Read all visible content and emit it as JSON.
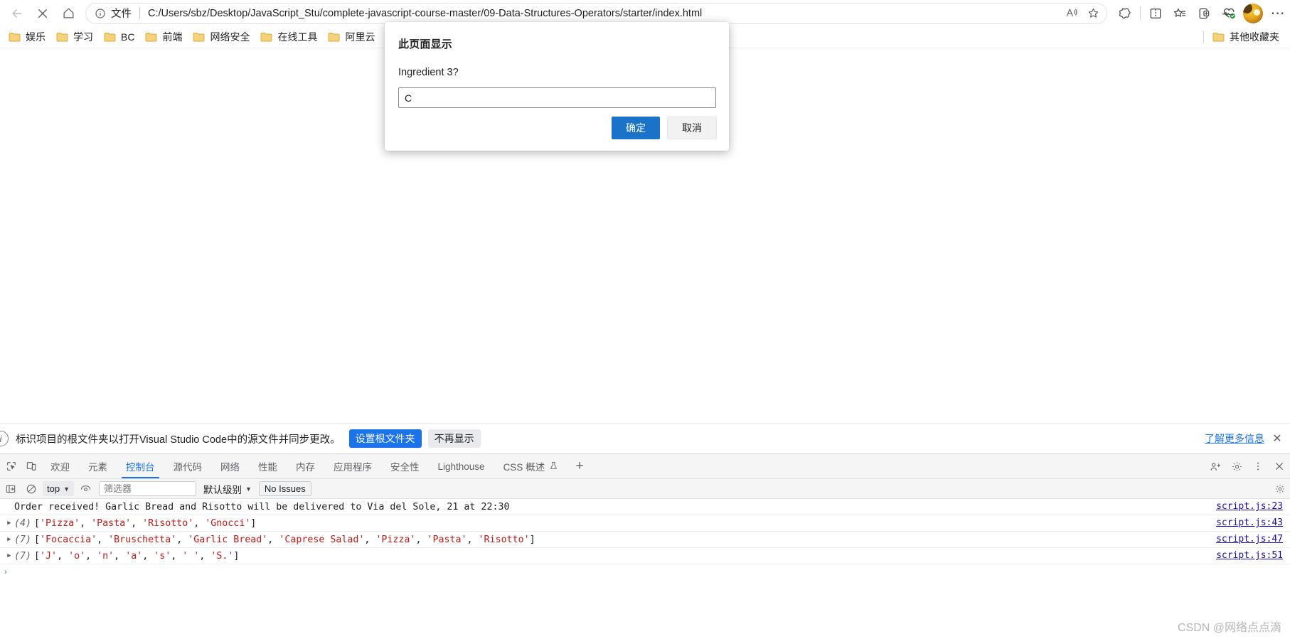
{
  "browser": {
    "nav": {
      "back_icon": "back-arrow-icon",
      "stop_icon": "stop-close-icon",
      "home_icon": "home-icon"
    },
    "omnibox": {
      "info_icon": "info-circle-icon",
      "file_label": "文件",
      "url": "C:/Users/sbz/Desktop/JavaScript_Stu/complete-javascript-course-master/09-Data-Structures-Operators/starter/index.html",
      "read_aloud_icon": "read-aloud-icon",
      "favorite_icon": "star-outline-icon"
    },
    "toolbar_icons": [
      {
        "name": "browser-essentials-icon",
        "label": "浏览器基本功能"
      },
      {
        "name": "split-screen-icon",
        "label": "拆分屏幕"
      },
      {
        "name": "collections-icon",
        "label": "收藏集"
      },
      {
        "name": "add-page-icon",
        "label": "添加页面"
      },
      {
        "name": "performance-heart-icon",
        "label": "性能检测"
      }
    ],
    "profile_icon": "profile-avatar",
    "more_icon": "more-options-icon"
  },
  "bookmarks": {
    "items": [
      {
        "label": "娱乐",
        "icon": "folder-icon"
      },
      {
        "label": "学习",
        "icon": "folder-icon"
      },
      {
        "label": "BC",
        "icon": "folder-icon"
      },
      {
        "label": "前端",
        "icon": "folder-icon"
      },
      {
        "label": "网络安全",
        "icon": "folder-icon"
      },
      {
        "label": "在线工具",
        "icon": "folder-icon"
      },
      {
        "label": "阿里云",
        "icon": "folder-icon"
      }
    ],
    "other_favorites": {
      "label": "其他收藏夹",
      "icon": "folder-icon"
    }
  },
  "dialog": {
    "title": "此页面显示",
    "message": "Ingredient 3?",
    "input_value": "C",
    "input_placeholder": "",
    "confirm_label": "确定",
    "cancel_label": "取消",
    "accent_color": "#1a73c8"
  },
  "info_bar": {
    "icon": "info-circle-icon",
    "text": "标识项目的根文件夹以打开Visual Studio Code中的源文件并同步更改。",
    "primary_button": "设置根文件夹",
    "secondary_button": "不再显示",
    "learn_more": "了解更多信息",
    "close_icon": "close-icon"
  },
  "devtools": {
    "left_icons": [
      {
        "name": "inspect-element-icon"
      },
      {
        "name": "device-toolbar-icon"
      }
    ],
    "tabs": [
      {
        "label": "欢迎",
        "active": false
      },
      {
        "label": "元素",
        "active": false
      },
      {
        "label": "控制台",
        "active": true
      },
      {
        "label": "源代码",
        "active": false
      },
      {
        "label": "网络",
        "active": false
      },
      {
        "label": "性能",
        "active": false
      },
      {
        "label": "内存",
        "active": false
      },
      {
        "label": "应用程序",
        "active": false
      },
      {
        "label": "安全性",
        "active": false
      },
      {
        "label": "Lighthouse",
        "active": false
      },
      {
        "label": "CSS 概述",
        "active": false,
        "flask": "⚗"
      }
    ],
    "add_tab_icon": "plus-icon",
    "right_icons": [
      {
        "name": "devtools-share-icon"
      },
      {
        "name": "settings-gear-icon"
      },
      {
        "name": "more-vertical-icon"
      },
      {
        "name": "close-icon"
      }
    ],
    "filter_bar": {
      "sidebar_icon": "console-sidebar-icon",
      "clear_icon": "clear-console-icon",
      "context_value": "top",
      "eye_icon": "live-expression-icon",
      "filter_placeholder": "筛选器",
      "filter_value": "",
      "level_label": "默认级别",
      "issues_label": "No Issues",
      "settings_icon": "settings-gear-icon"
    },
    "console_logs": [
      {
        "kind": "text",
        "text": "Order received! Garlic Bread and Risotto will be delivered to Via del Sole, 21 at 22:30",
        "source": "script.js:23",
        "expandable": false
      },
      {
        "kind": "array",
        "count": "(4)",
        "items": [
          "'Pizza'",
          "'Pasta'",
          "'Risotto'",
          "'Gnocci'"
        ],
        "source": "script.js:43",
        "expandable": true
      },
      {
        "kind": "array",
        "count": "(7)",
        "items": [
          "'Focaccia'",
          "'Bruschetta'",
          "'Garlic Bread'",
          "'Caprese Salad'",
          "'Pizza'",
          "'Pasta'",
          "'Risotto'"
        ],
        "source": "script.js:47",
        "expandable": true
      },
      {
        "kind": "array",
        "count": "(7)",
        "items": [
          "'J'",
          "'o'",
          "'n'",
          "'a'",
          "'s'",
          "' '",
          "'S.'"
        ],
        "source": "script.js:51",
        "expandable": true
      }
    ],
    "prompt_caret": "›"
  },
  "watermark": "CSDN @网络点点滴"
}
